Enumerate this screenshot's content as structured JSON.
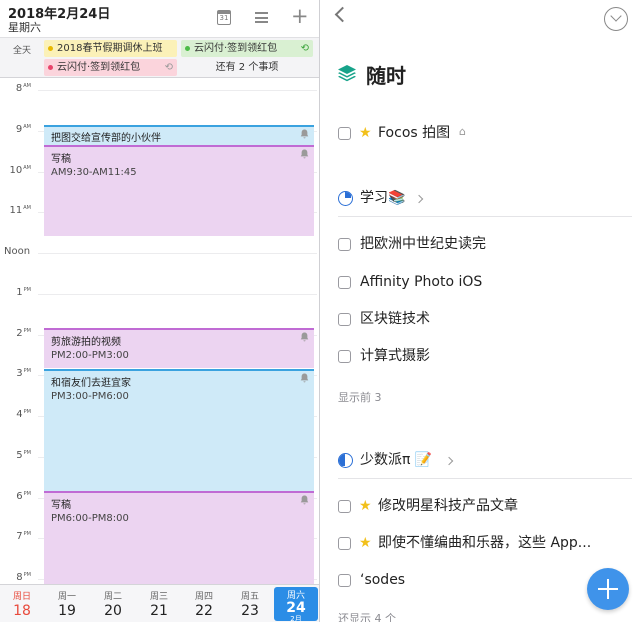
{
  "calendar": {
    "date_title": "2018年2月24日",
    "weekday": "星期六",
    "calendar_icon_number": "31",
    "allday_label": "全天",
    "allday_events": [
      {
        "title": "2018春节假期调休上班"
      },
      {
        "title": "云闪付·签到领红包"
      },
      {
        "title": "云闪付·签到领红包"
      }
    ],
    "more_events": "还有 2 个事项",
    "hours": [
      {
        "label": "8",
        "suffix": "AM"
      },
      {
        "label": "9",
        "suffix": "AM"
      },
      {
        "label": "10",
        "suffix": "AM"
      },
      {
        "label": "11",
        "suffix": "AM"
      },
      {
        "label": "Noon",
        "suffix": ""
      },
      {
        "label": "1",
        "suffix": "PM"
      },
      {
        "label": "2",
        "suffix": "PM"
      },
      {
        "label": "3",
        "suffix": "PM"
      },
      {
        "label": "4",
        "suffix": "PM"
      },
      {
        "label": "5",
        "suffix": "PM"
      },
      {
        "label": "6",
        "suffix": "PM"
      },
      {
        "label": "7",
        "suffix": "PM"
      },
      {
        "label": "8",
        "suffix": "PM"
      }
    ],
    "events": [
      {
        "title": "把图交给宣传部的小伙伴",
        "time": ""
      },
      {
        "title": "写稿",
        "time": "AM9:30-AM11:45"
      },
      {
        "title": "剪旅游拍的视频",
        "time": "PM2:00-PM3:00"
      },
      {
        "title": "和宿友们去逛宜家",
        "time": "PM3:00-PM6:00"
      },
      {
        "title": "写稿",
        "time": "PM6:00-PM8:00"
      }
    ],
    "week": [
      {
        "name": "周日",
        "num": "18"
      },
      {
        "name": "周一",
        "num": "19"
      },
      {
        "name": "周二",
        "num": "20"
      },
      {
        "name": "周三",
        "num": "21"
      },
      {
        "name": "周四",
        "num": "22"
      },
      {
        "name": "周五",
        "num": "23"
      },
      {
        "name": "周六",
        "num": "24",
        "month": "2月"
      }
    ]
  },
  "tasks": {
    "list_title": "随时",
    "top_task": {
      "label": "Focos 拍图",
      "starred": true
    },
    "groups": [
      {
        "title": "学习📚",
        "items": [
          "把欧洲中世纪史读完",
          "Affinity Photo iOS",
          "区块链技术",
          "计算式摄影"
        ],
        "show_more": "显示前 3"
      },
      {
        "title": "少数派π 📝",
        "items": [
          "修改明星科技产品文章",
          "即使不懂编曲和乐器，这些 App...",
          "‘sodes"
        ],
        "show_more": "还显示 4 个"
      }
    ]
  },
  "colors": {
    "accent_blue": "#3f93ea",
    "event_blue": "#cfeaf8",
    "event_purple": "#ecd4f1",
    "sunday_red": "#e84a3c",
    "star_yellow": "#f2c01a"
  }
}
